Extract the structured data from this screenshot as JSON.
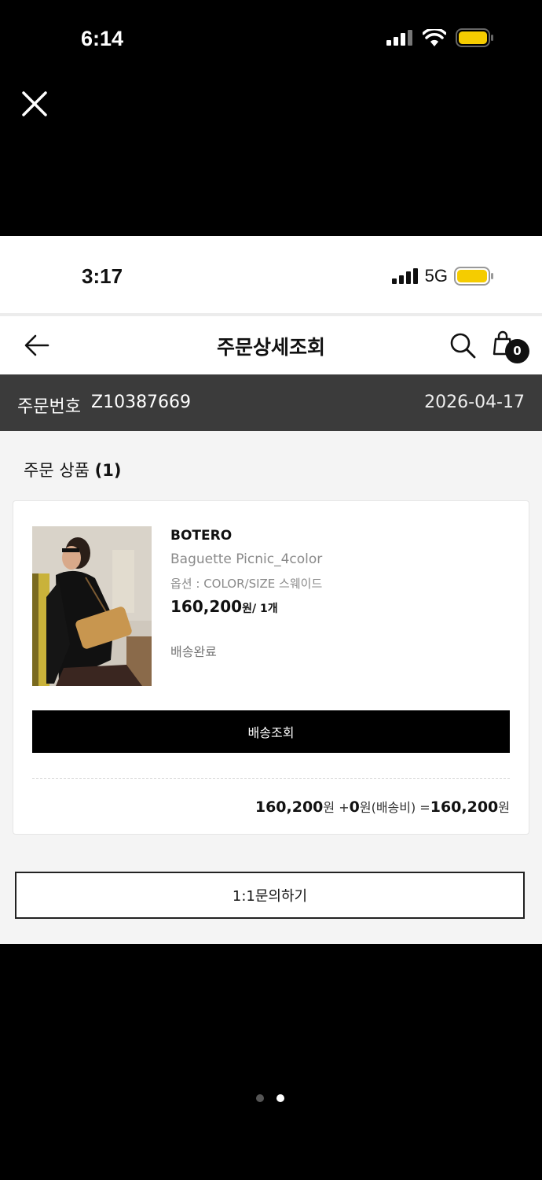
{
  "outer_status": {
    "time": "6:14"
  },
  "inner_status": {
    "time": "3:17",
    "network": "5G"
  },
  "header": {
    "title": "주문상세조회",
    "cart_count": "0"
  },
  "order": {
    "label": "주문번호",
    "number": "Z10387669",
    "date": "2026-04-17"
  },
  "section": {
    "title": "주문 상품",
    "count": "(1)"
  },
  "product": {
    "brand": "BOTERO",
    "name": "Baguette Picnic_4color",
    "option": "옵션 : COLOR/SIZE 스웨이드",
    "price": "160,200",
    "price_unit": "원/ 1개",
    "status": "배송완료"
  },
  "buttons": {
    "track": "배송조회",
    "inquiry": "1:1문의하기"
  },
  "totals": {
    "subtotal": "160,200",
    "subtotal_unit": "원 +",
    "shipping": "0",
    "shipping_unit": "원(배송비) =",
    "total": "160,200",
    "total_unit": "원"
  },
  "pager": {
    "pages": 2,
    "active": 2
  },
  "colors": {
    "battery": "#f5cc00",
    "order_bar": "#3b3b3b",
    "button": "#000000"
  },
  "icons": [
    "close-icon",
    "back-arrow-icon",
    "search-icon",
    "shopping-bag-icon",
    "signal-icon",
    "wifi-icon",
    "battery-icon"
  ]
}
